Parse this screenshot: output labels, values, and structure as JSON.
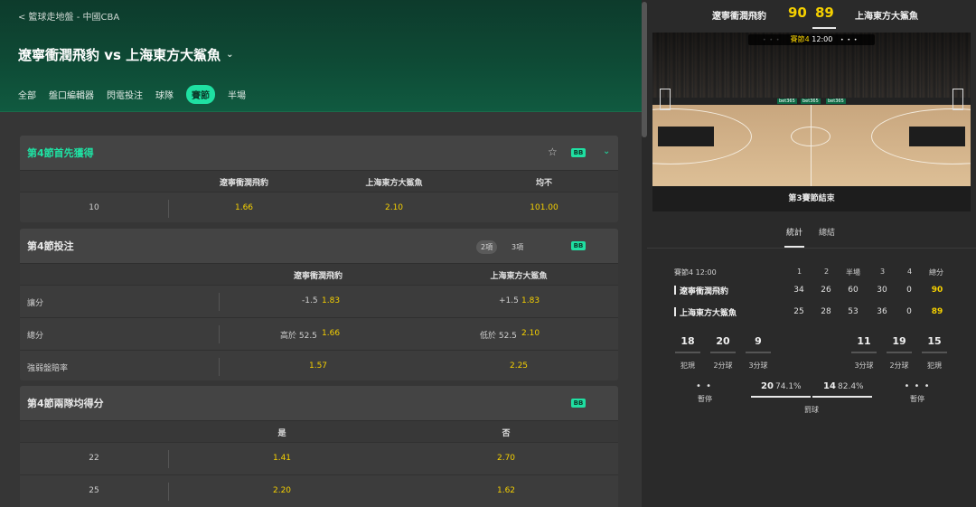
{
  "header": {
    "breadcrumb": "< 籃球走地盤 - 中國CBA",
    "match_title": "遼寧衝潤飛豹 vs 上海東方大鯊魚",
    "tabs": [
      "全部",
      "盤口編輯器",
      "閃電投注",
      "球隊",
      "賽節",
      "半場"
    ],
    "active_tab": "賽節"
  },
  "colors": {
    "accent": "#1fe0a2",
    "odds": "#f5d000",
    "header_bg": "#0e4a35"
  },
  "markets": [
    {
      "title": "第4節首先獲得",
      "badge": "BB",
      "columns": [
        "遼寧衝潤飛豹",
        "上海東方大鯊魚",
        "均不"
      ],
      "rows": [
        {
          "label": "10",
          "odds": [
            "1.66",
            "2.10",
            "101.00"
          ]
        }
      ]
    },
    {
      "title": "第4節投注",
      "badge": "BB",
      "segments": [
        "2項",
        "3項"
      ],
      "columns": [
        "遼寧衝潤飛豹",
        "上海東方大鯊魚"
      ],
      "rows": [
        {
          "label": "讓分",
          "lines": [
            "-1.5",
            "+1.5"
          ],
          "odds": [
            "1.83",
            "1.83"
          ]
        },
        {
          "label": "總分",
          "lines": [
            "高於 52.5",
            "低於 52.5"
          ],
          "odds": [
            "1.66",
            "2.10"
          ]
        },
        {
          "label": "強弱盤賠率",
          "lines": [
            "",
            ""
          ],
          "odds": [
            "1.57",
            "2.25"
          ]
        }
      ]
    },
    {
      "title": "第4節兩隊均得分",
      "badge": "BB",
      "columns": [
        "是",
        "否"
      ],
      "rows": [
        {
          "label": "22",
          "odds": [
            "1.41",
            "2.70"
          ]
        },
        {
          "label": "25",
          "odds": [
            "2.20",
            "1.62"
          ]
        }
      ]
    }
  ],
  "scoreboard": {
    "home_name": "遼寧衝潤飛豹",
    "away_name": "上海東方大鯊魚",
    "home_score": "90",
    "away_score": "89",
    "clock_period": "賽節4",
    "clock_time": "12:00",
    "court_status": "第3賽節結束",
    "ad_text": "bet365"
  },
  "stats_tabs": [
    "統計",
    "總結"
  ],
  "score_grid": {
    "header_label": "賽節4  12:00",
    "columns": [
      "1",
      "2",
      "半場",
      "3",
      "4",
      "總分"
    ],
    "teams": [
      {
        "name": "遼寧衝潤飛豹",
        "values": [
          "34",
          "26",
          "60",
          "30",
          "0"
        ],
        "total": "90"
      },
      {
        "name": "上海東方大鯊魚",
        "values": [
          "25",
          "28",
          "53",
          "36",
          "0"
        ],
        "total": "89"
      }
    ]
  },
  "team_stats": {
    "home": [
      {
        "value": "18",
        "label": "犯規"
      },
      {
        "value": "20",
        "label": "2分球"
      },
      {
        "value": "9",
        "label": "3分球"
      }
    ],
    "away": [
      {
        "value": "11",
        "label": "3分球"
      },
      {
        "value": "19",
        "label": "2分球"
      },
      {
        "value": "15",
        "label": "犯規"
      }
    ]
  },
  "free_throws": {
    "home_value": "20",
    "home_pct": "74.1%",
    "away_value": "14",
    "away_pct": "82.4%",
    "label": "罰球"
  },
  "timeouts": {
    "label": "暫停",
    "home_dots": "• •",
    "away_dots": "• • •"
  }
}
